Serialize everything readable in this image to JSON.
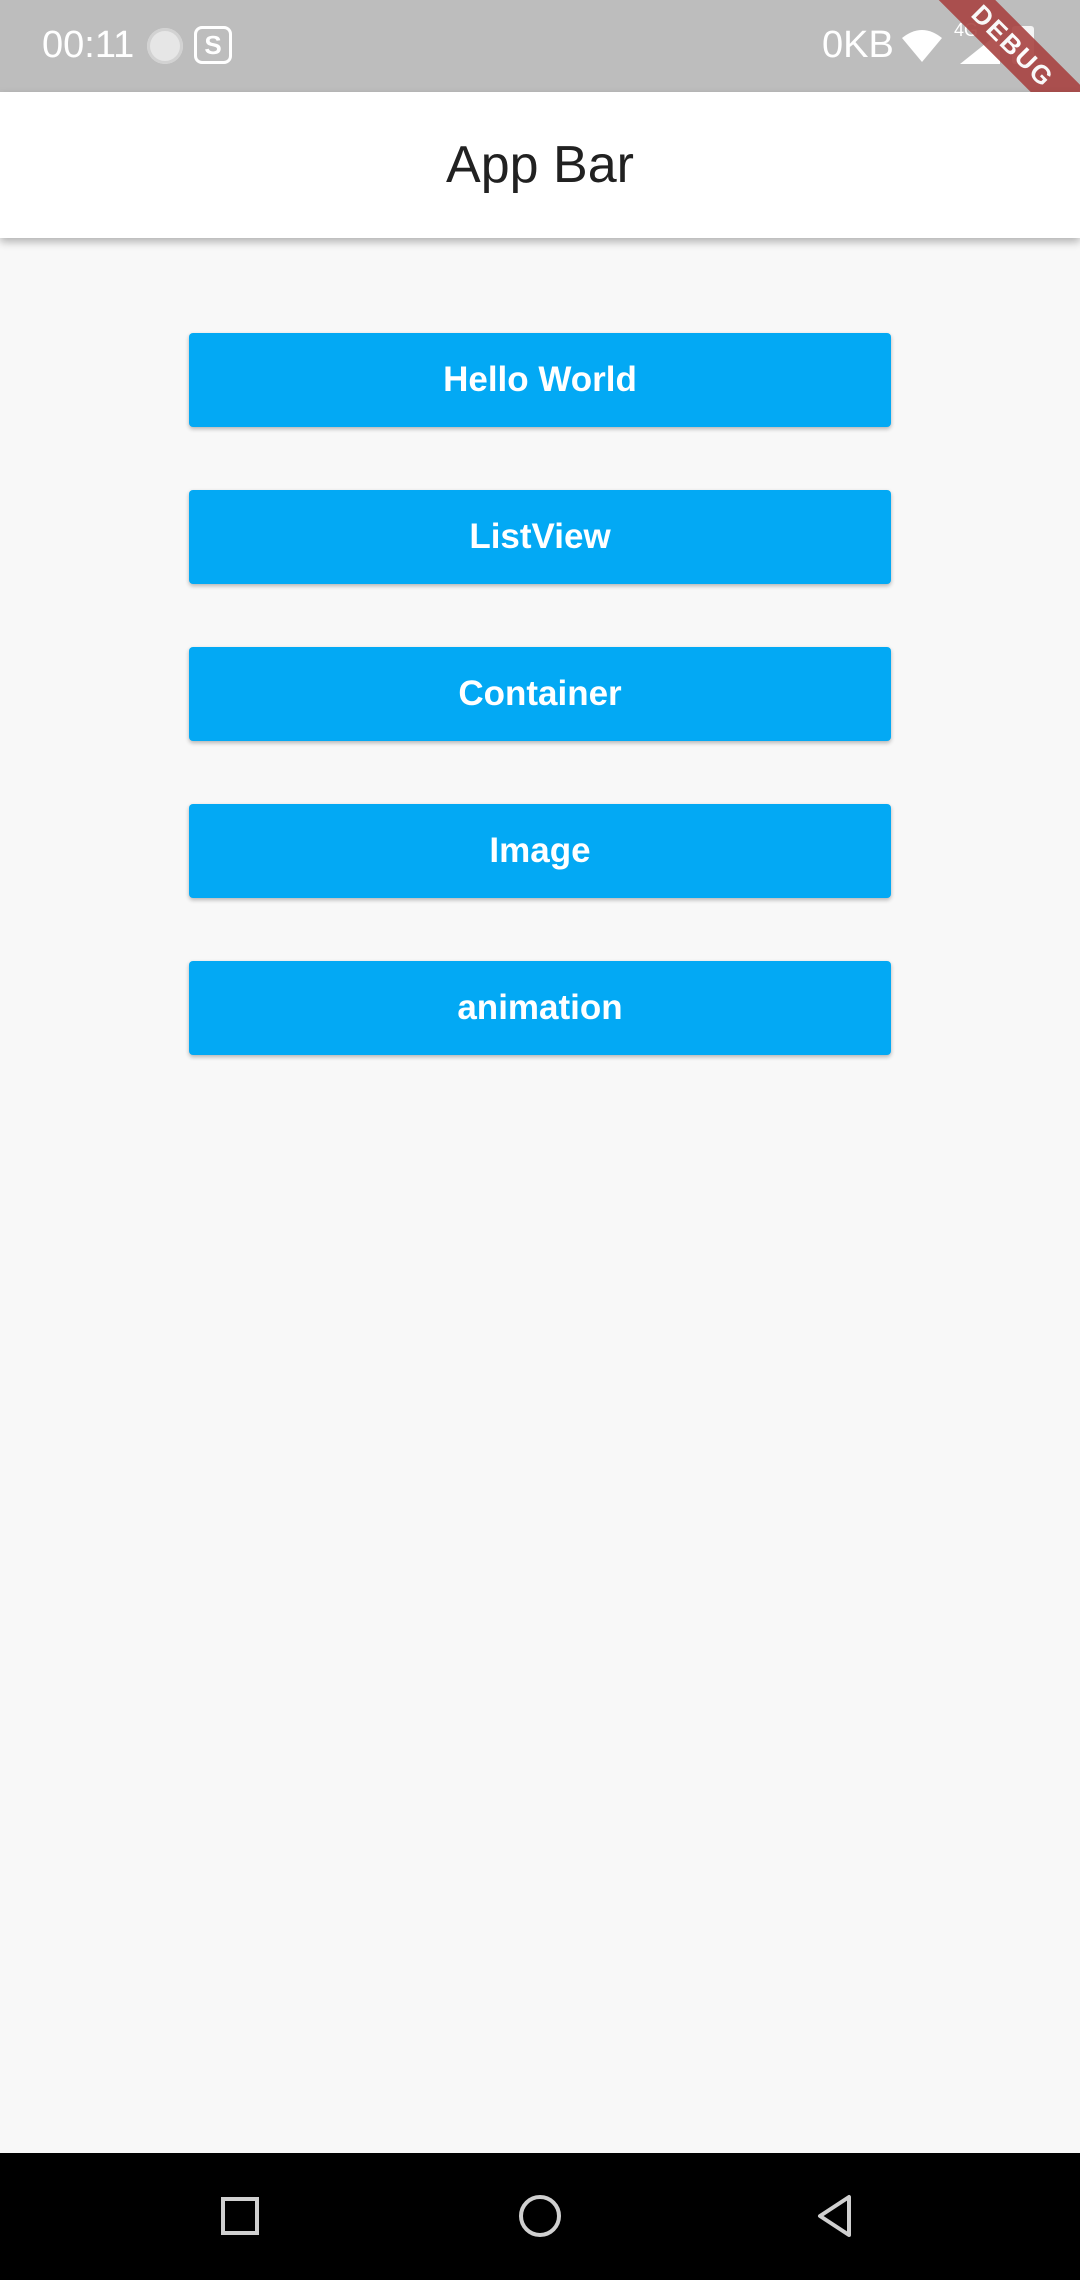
{
  "status_bar": {
    "time": "00:11",
    "app_icon_letter": "S",
    "network_speed": "0KB",
    "network_type": "4G",
    "icons": [
      "notification-dot-icon",
      "s-app-icon",
      "wifi-icon",
      "signal-icon",
      "battery-icon"
    ],
    "background": "#bdbdbd"
  },
  "debug_banner": {
    "label": "DEBUG"
  },
  "app_bar": {
    "title": "App Bar",
    "background": "#ffffff"
  },
  "buttons": [
    {
      "label": "Hello World"
    },
    {
      "label": "ListView"
    },
    {
      "label": "Container"
    },
    {
      "label": "Image"
    },
    {
      "label": "animation"
    }
  ],
  "button_color": "#03a9f4",
  "nav_bar": {
    "icons": [
      "recents-square-icon",
      "home-circle-icon",
      "back-triangle-icon"
    ]
  }
}
